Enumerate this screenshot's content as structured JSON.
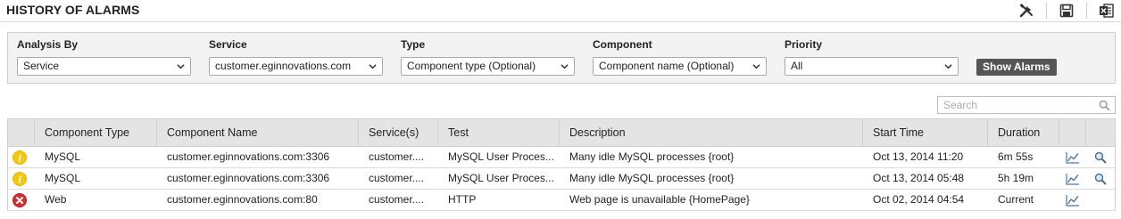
{
  "header": {
    "title": "HISTORY OF ALARMS",
    "icons": [
      "tools-icon",
      "save-icon",
      "excel-export-icon"
    ]
  },
  "filters": {
    "analysis_by": {
      "label": "Analysis By",
      "value": "Service"
    },
    "service": {
      "label": "Service",
      "value": "customer.eginnovations.com"
    },
    "type": {
      "label": "Type",
      "value": "Component type (Optional)"
    },
    "component": {
      "label": "Component",
      "value": "Component name (Optional)"
    },
    "priority": {
      "label": "Priority",
      "value": "All"
    },
    "show_button": "Show Alarms"
  },
  "search": {
    "placeholder": "Search"
  },
  "table": {
    "columns": [
      "",
      "Component Type",
      "Component Name",
      "Service(s)",
      "Test",
      "Description",
      "Start Time",
      "Duration",
      "",
      ""
    ],
    "rows": [
      {
        "severity": "minor",
        "component_type": "MySQL",
        "component_name": "customer.eginnovations.com:3306",
        "services": "customer....",
        "test": "MySQL User Proces...",
        "description": "Many idle MySQL processes {root}",
        "start_time": "Oct 13, 2014 11:20",
        "duration": "6m 55s",
        "has_details": true
      },
      {
        "severity": "minor",
        "component_type": "MySQL",
        "component_name": "customer.eginnovations.com:3306",
        "services": "customer....",
        "test": "MySQL User Proces...",
        "description": "Many idle MySQL processes {root}",
        "start_time": "Oct 13, 2014 05:48",
        "duration": "5h 19m",
        "has_details": true
      },
      {
        "severity": "critical",
        "component_type": "Web",
        "component_name": "customer.eginnovations.com:80",
        "services": "customer....",
        "test": "HTTP",
        "description": "Web page is unavailable {HomePage}",
        "start_time": "Oct 02, 2014 04:54",
        "duration": "Current",
        "has_details": false
      }
    ]
  },
  "colors": {
    "minor": "#e6b800",
    "critical": "#c62828",
    "button": "#555555",
    "header_bg": "#e4e4e4",
    "panel_bg": "#f3f3f3"
  }
}
